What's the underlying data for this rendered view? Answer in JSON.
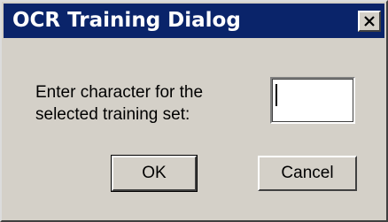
{
  "window": {
    "title": "OCR Training Dialog",
    "close_symbol": "×",
    "title_bar_color": "#0a246a",
    "background_color": "#d4d0c8"
  },
  "prompt": {
    "line1": "Enter character for the",
    "line2": "selected training set:"
  },
  "input": {
    "value": ""
  },
  "buttons": {
    "ok_label": "OK",
    "cancel_label": "Cancel"
  },
  "icons": {
    "close": "close-icon"
  }
}
